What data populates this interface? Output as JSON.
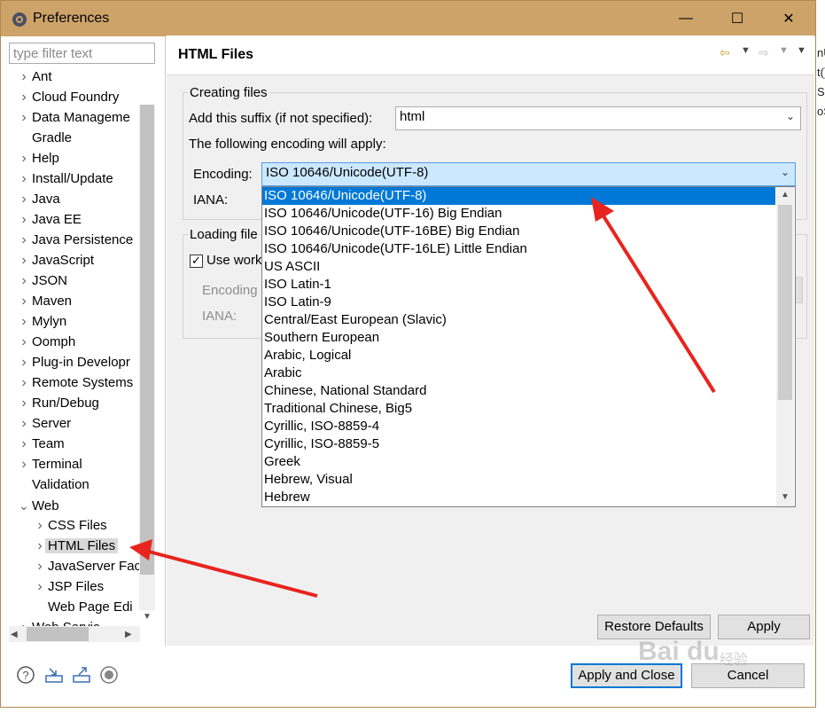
{
  "window": {
    "title": "Preferences",
    "minimize_glyph": "—",
    "maximize_glyph": "☐",
    "close_glyph": "✕"
  },
  "background_fragments": [
    "nU",
    "t()",
    "Se",
    "oS"
  ],
  "filter": {
    "placeholder": "type filter text",
    "value": ""
  },
  "tree": {
    "nodes": [
      {
        "label": "Ant",
        "expander": "collapsed"
      },
      {
        "label": "Cloud Foundry",
        "expander": "collapsed"
      },
      {
        "label": "Data Manageme",
        "expander": "collapsed"
      },
      {
        "label": "Gradle",
        "expander": "none"
      },
      {
        "label": "Help",
        "expander": "collapsed"
      },
      {
        "label": "Install/Update",
        "expander": "collapsed"
      },
      {
        "label": "Java",
        "expander": "collapsed"
      },
      {
        "label": "Java EE",
        "expander": "collapsed"
      },
      {
        "label": "Java Persistence",
        "expander": "collapsed"
      },
      {
        "label": "JavaScript",
        "expander": "collapsed"
      },
      {
        "label": "JSON",
        "expander": "collapsed"
      },
      {
        "label": "Maven",
        "expander": "collapsed"
      },
      {
        "label": "Mylyn",
        "expander": "collapsed"
      },
      {
        "label": "Oomph",
        "expander": "collapsed"
      },
      {
        "label": "Plug-in Developr",
        "expander": "collapsed"
      },
      {
        "label": "Remote Systems",
        "expander": "collapsed"
      },
      {
        "label": "Run/Debug",
        "expander": "collapsed"
      },
      {
        "label": "Server",
        "expander": "collapsed"
      },
      {
        "label": "Team",
        "expander": "collapsed"
      },
      {
        "label": "Terminal",
        "expander": "collapsed"
      },
      {
        "label": "Validation",
        "expander": "none"
      },
      {
        "label": "Web",
        "expander": "expanded"
      },
      {
        "label": "CSS Files",
        "expander": "collapsed",
        "child": true
      },
      {
        "label": "HTML Files",
        "expander": "collapsed",
        "child": true,
        "selected": true
      },
      {
        "label": "JavaServer Fac",
        "expander": "collapsed",
        "child": true
      },
      {
        "label": "JSP Files",
        "expander": "collapsed",
        "child": true
      },
      {
        "label": "Web Page Edi",
        "expander": "none",
        "child": true
      },
      {
        "label": "Web Servic",
        "expander": "collapsed"
      }
    ]
  },
  "page": {
    "title": "HTML Files",
    "creating_files": {
      "group_label": "Creating files",
      "suffix_label": "Add this suffix (if not specified):",
      "suffix_value": "html",
      "encoding_note": "The following encoding will apply:",
      "encoding_label": "Encoding:",
      "encoding_value": "ISO 10646/Unicode(UTF-8)",
      "iana_label": "IANA:"
    },
    "loading_files": {
      "group_label": "Loading file",
      "checkbox_label": "Use work",
      "checkbox_checked": true,
      "encoding_label": "Encoding",
      "iana_label": "IANA:"
    }
  },
  "encoding_options": [
    "ISO 10646/Unicode(UTF-8)",
    "ISO 10646/Unicode(UTF-16) Big Endian",
    "ISO 10646/Unicode(UTF-16BE) Big Endian",
    "ISO 10646/Unicode(UTF-16LE) Little Endian",
    "US ASCII",
    "ISO Latin-1",
    "ISO Latin-9",
    "Central/East European (Slavic)",
    "Southern European",
    "Arabic, Logical",
    "Arabic",
    "Chinese, National Standard",
    "Traditional Chinese, Big5",
    "Cyrillic, ISO-8859-4",
    "Cyrillic, ISO-8859-5",
    "Greek",
    "Hebrew, Visual",
    "Hebrew"
  ],
  "highlighted_option_index": 0,
  "buttons": {
    "restore_defaults": "Restore Defaults",
    "apply": "Apply",
    "apply_and_close": "Apply and Close",
    "cancel": "Cancel"
  },
  "bottom_icons": [
    "help-icon",
    "import-icon",
    "export-icon",
    "record-icon"
  ],
  "watermark": {
    "brand": "Bai du",
    "sub": "经验"
  },
  "colors": {
    "titlebar": "#cda36a",
    "selection": "#0078d7",
    "annotation_arrow": "#e8241f"
  }
}
